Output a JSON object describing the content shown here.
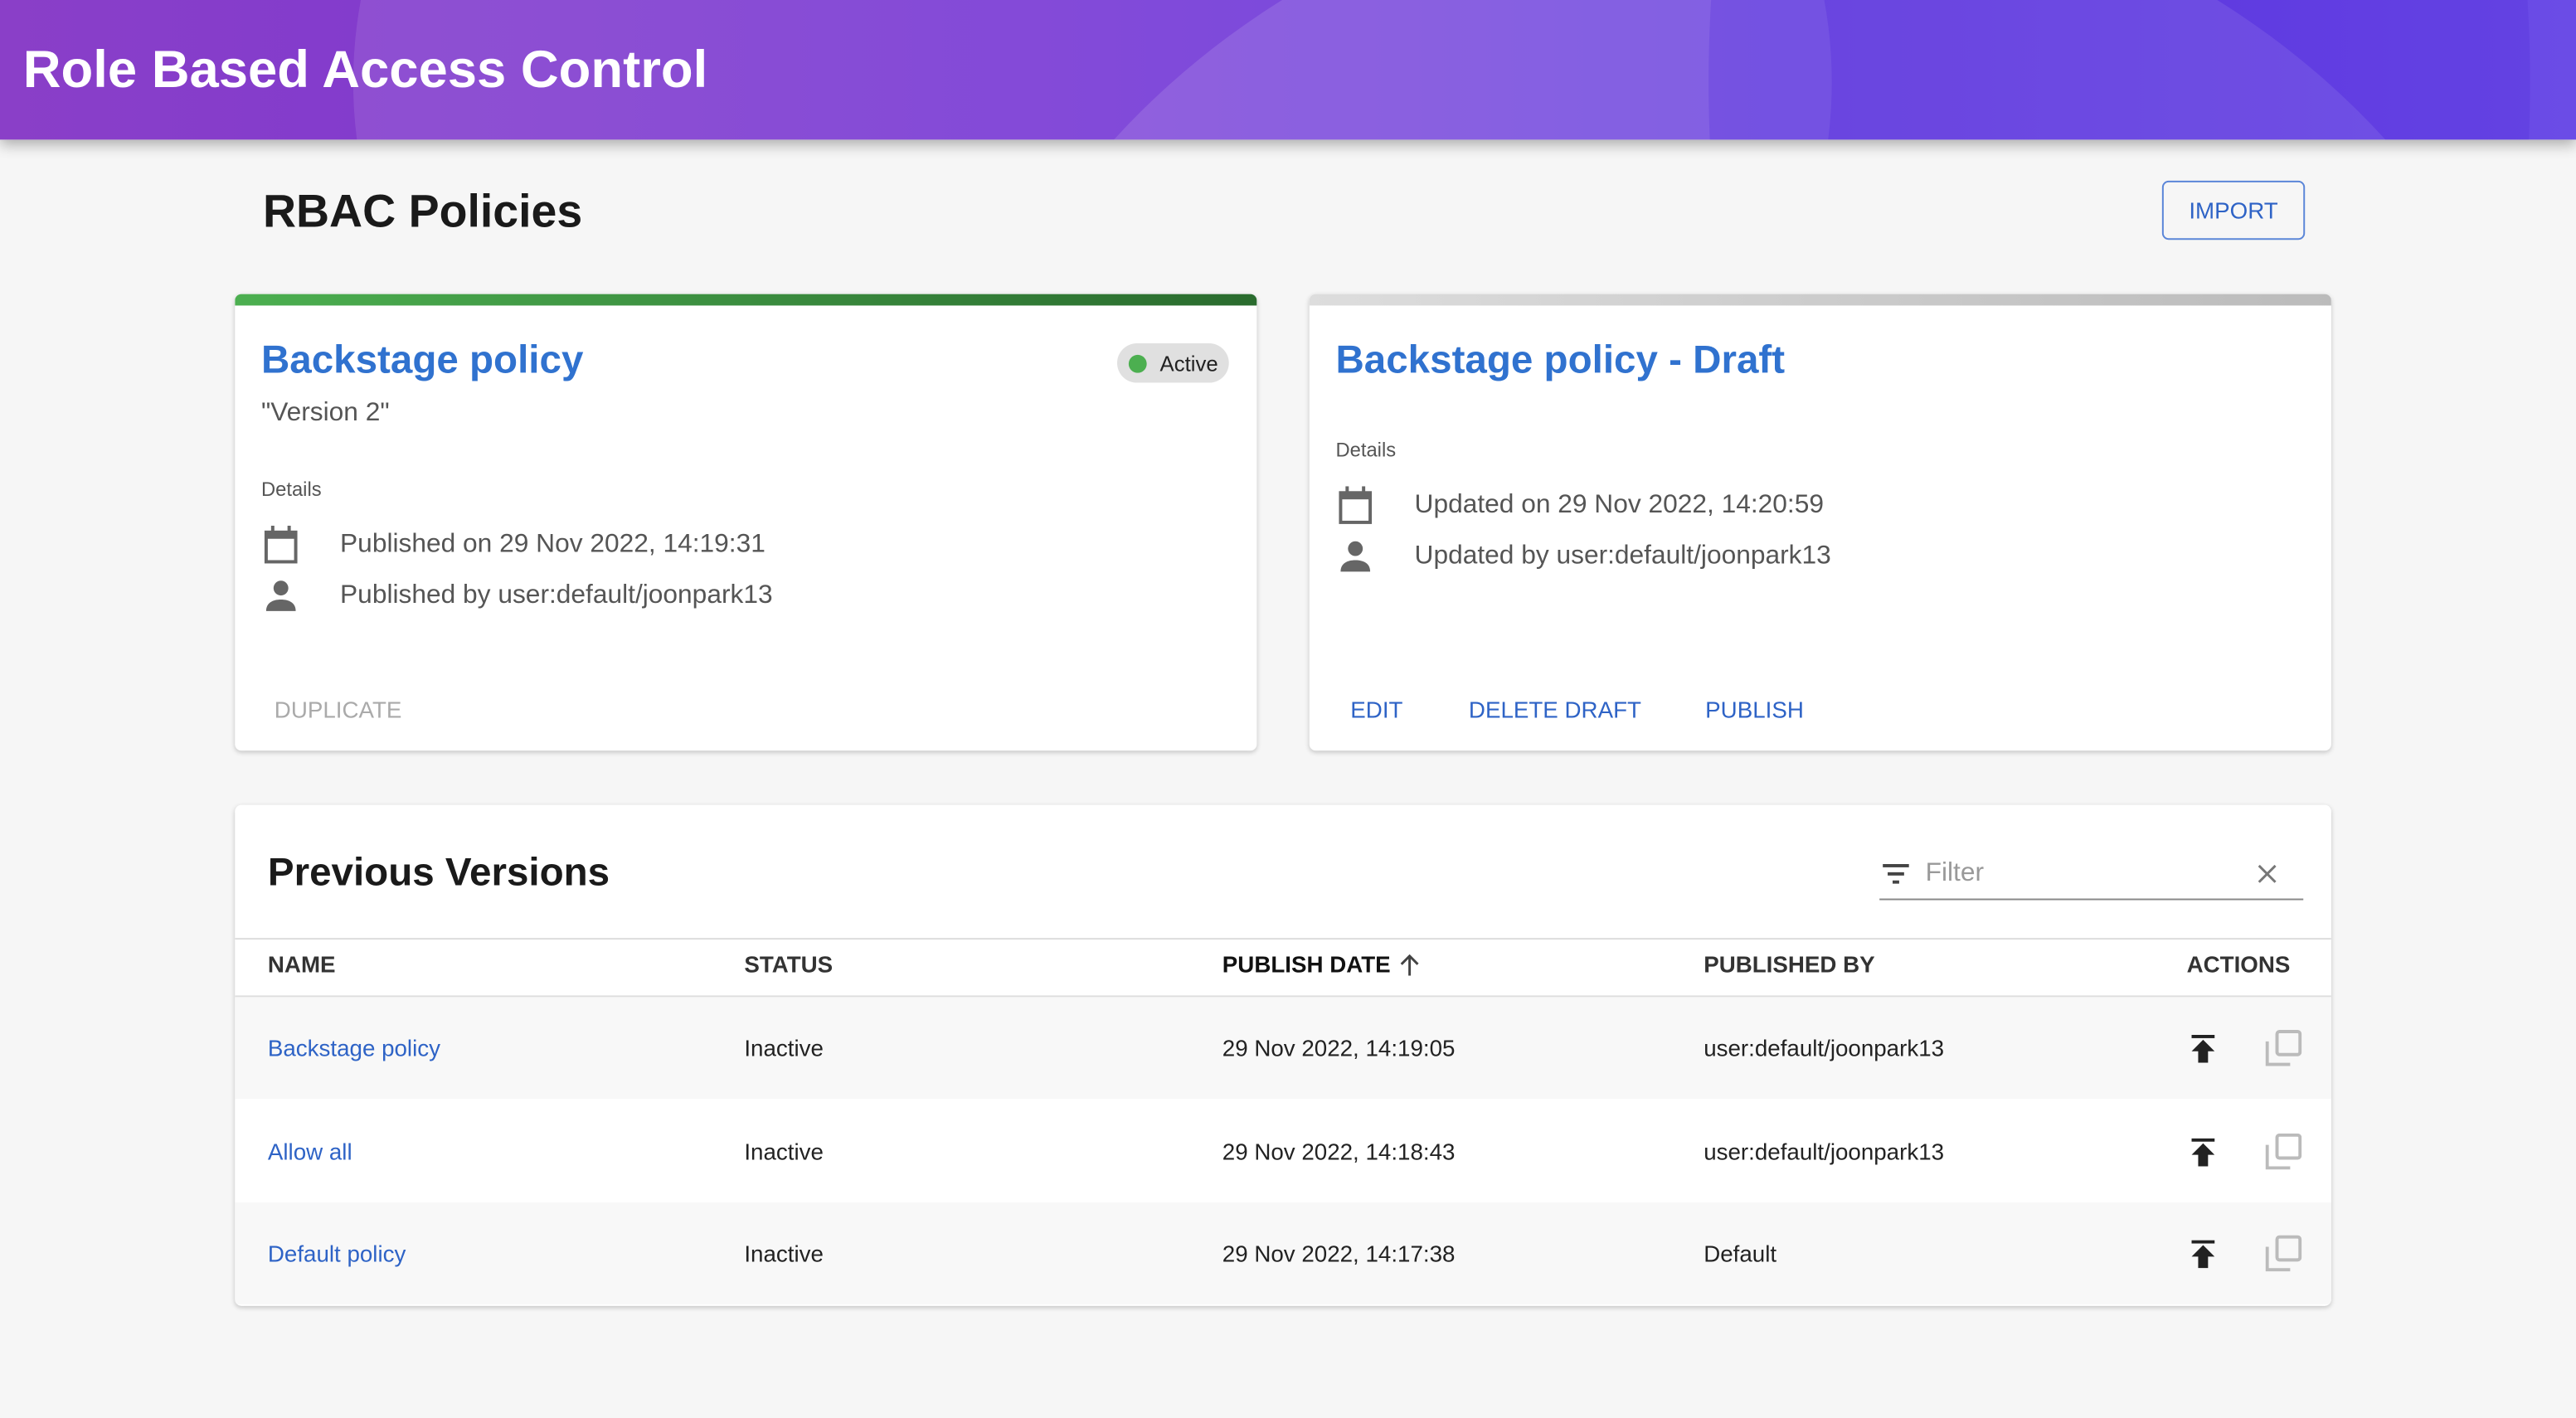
{
  "app": {
    "title": "Role Based Access Control"
  },
  "page": {
    "title": "RBAC Policies",
    "import_label": "IMPORT"
  },
  "active_policy": {
    "title": "Backstage policy",
    "description": "\"Version 2\"",
    "status": "Active",
    "details_label": "Details",
    "published_on": "Published on 29 Nov 2022, 14:19:31",
    "published_by": "Published by user:default/joonpark13",
    "duplicate_label": "DUPLICATE"
  },
  "draft_policy": {
    "title": "Backstage policy - Draft",
    "details_label": "Details",
    "updated_on": "Updated on 29 Nov 2022, 14:20:59",
    "updated_by": "Updated by user:default/joonpark13",
    "edit_label": "EDIT",
    "delete_label": "DELETE DRAFT",
    "publish_label": "PUBLISH"
  },
  "versions": {
    "title": "Previous Versions",
    "filter_placeholder": "Filter",
    "columns": [
      "Name",
      "Status",
      "Publish Date",
      "Published By",
      "Actions"
    ],
    "rows": [
      {
        "name": "Backstage policy",
        "status": "Inactive",
        "date": "29 Nov 2022, 14:19:05",
        "by": "user:default/joonpark13"
      },
      {
        "name": "Allow all",
        "status": "Inactive",
        "date": "29 Nov 2022, 14:18:43",
        "by": "user:default/joonpark13"
      },
      {
        "name": "Default policy",
        "status": "Inactive",
        "date": "29 Nov 2022, 14:17:38",
        "by": "Default"
      }
    ]
  },
  "colors": {
    "accent": "#3072cf",
    "active": "#4caf50"
  }
}
